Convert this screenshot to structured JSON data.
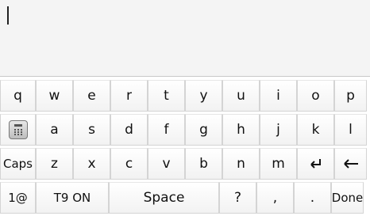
{
  "input": {
    "value": ""
  },
  "keyboard": {
    "row1": [
      "q",
      "w",
      "e",
      "r",
      "t",
      "y",
      "u",
      "i",
      "o",
      "p"
    ],
    "row2": [
      "a",
      "s",
      "d",
      "f",
      "g",
      "h",
      "j",
      "k",
      "l"
    ],
    "row3": {
      "caps": "Caps",
      "letters": [
        "z",
        "x",
        "c",
        "v",
        "b",
        "n",
        "m"
      ]
    },
    "row4": {
      "symbols": "1@",
      "t9": "T9 ON",
      "space": "Space",
      "question": "?",
      "comma": ",",
      "period": ".",
      "done": "Done"
    },
    "icons": {
      "calculator": "calculator-icon",
      "enter": "enter-icon",
      "backspace": "backspace-arrow-icon"
    }
  }
}
